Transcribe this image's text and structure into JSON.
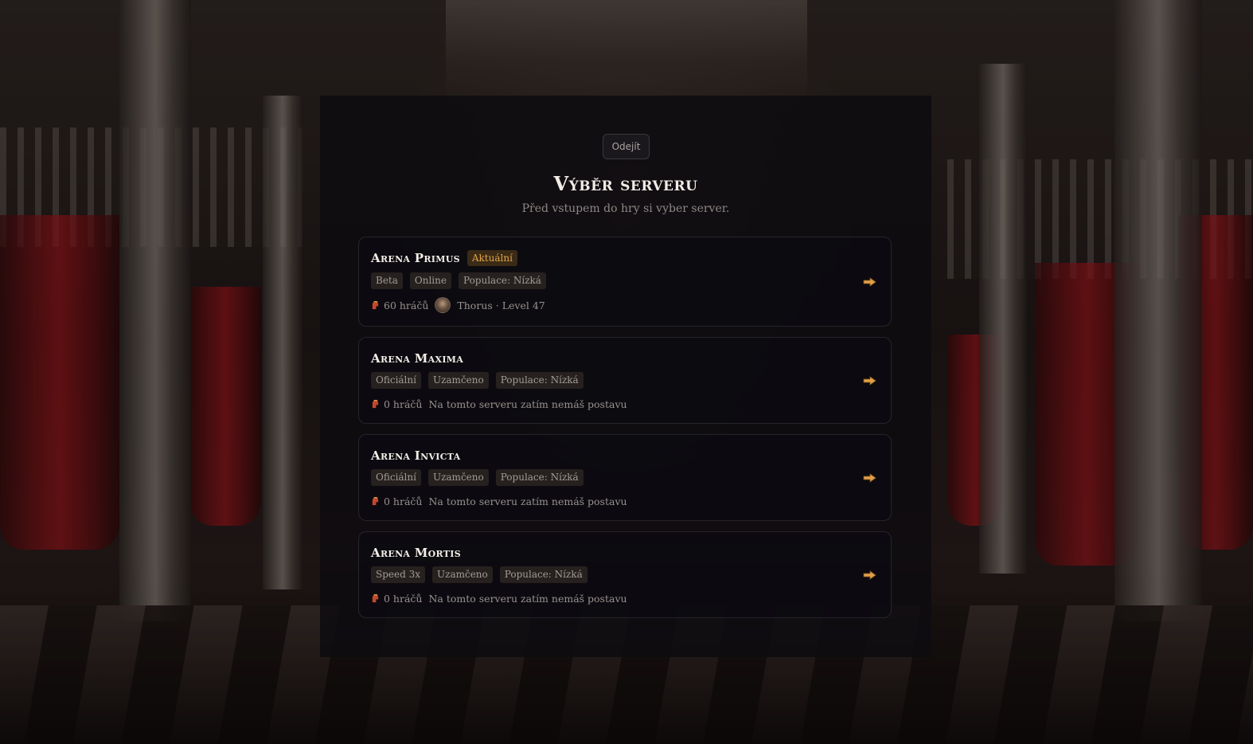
{
  "header": {
    "leave_label": "Odejít",
    "title": "Výběr serveru",
    "subtitle": "Před vstupem do hry si vyber server."
  },
  "colors": {
    "accent": "#e2a546",
    "panel": "#0e0c10",
    "text": "#f1ece6"
  },
  "servers": [
    {
      "name": "Arena Primus",
      "badge": "Aktuální",
      "tags": [
        "Beta",
        "Online",
        "Populace: Nízká"
      ],
      "players": "60 hráčů",
      "character": "Thorus · Level 47"
    },
    {
      "name": "Arena Maxima",
      "tags": [
        "Oficiální",
        "Uzamčeno",
        "Populace: Nízká"
      ],
      "players": "0 hráčů",
      "character": "Na tomto serveru zatím nemáš postavu"
    },
    {
      "name": "Arena Invicta",
      "tags": [
        "Oficiální",
        "Uzamčeno",
        "Populace: Nízká"
      ],
      "players": "0 hráčů",
      "character": "Na tomto serveru zatím nemáš postavu"
    },
    {
      "name": "Arena Mortis",
      "tags": [
        "Speed 3x",
        "Uzamčeno",
        "Populace: Nízká"
      ],
      "players": "0 hráčů",
      "character": "Na tomto serveru zatím nemáš postavu"
    }
  ],
  "icons": {
    "players": "helmet-icon",
    "enter": "arrow-right-icon",
    "character": "avatar"
  }
}
